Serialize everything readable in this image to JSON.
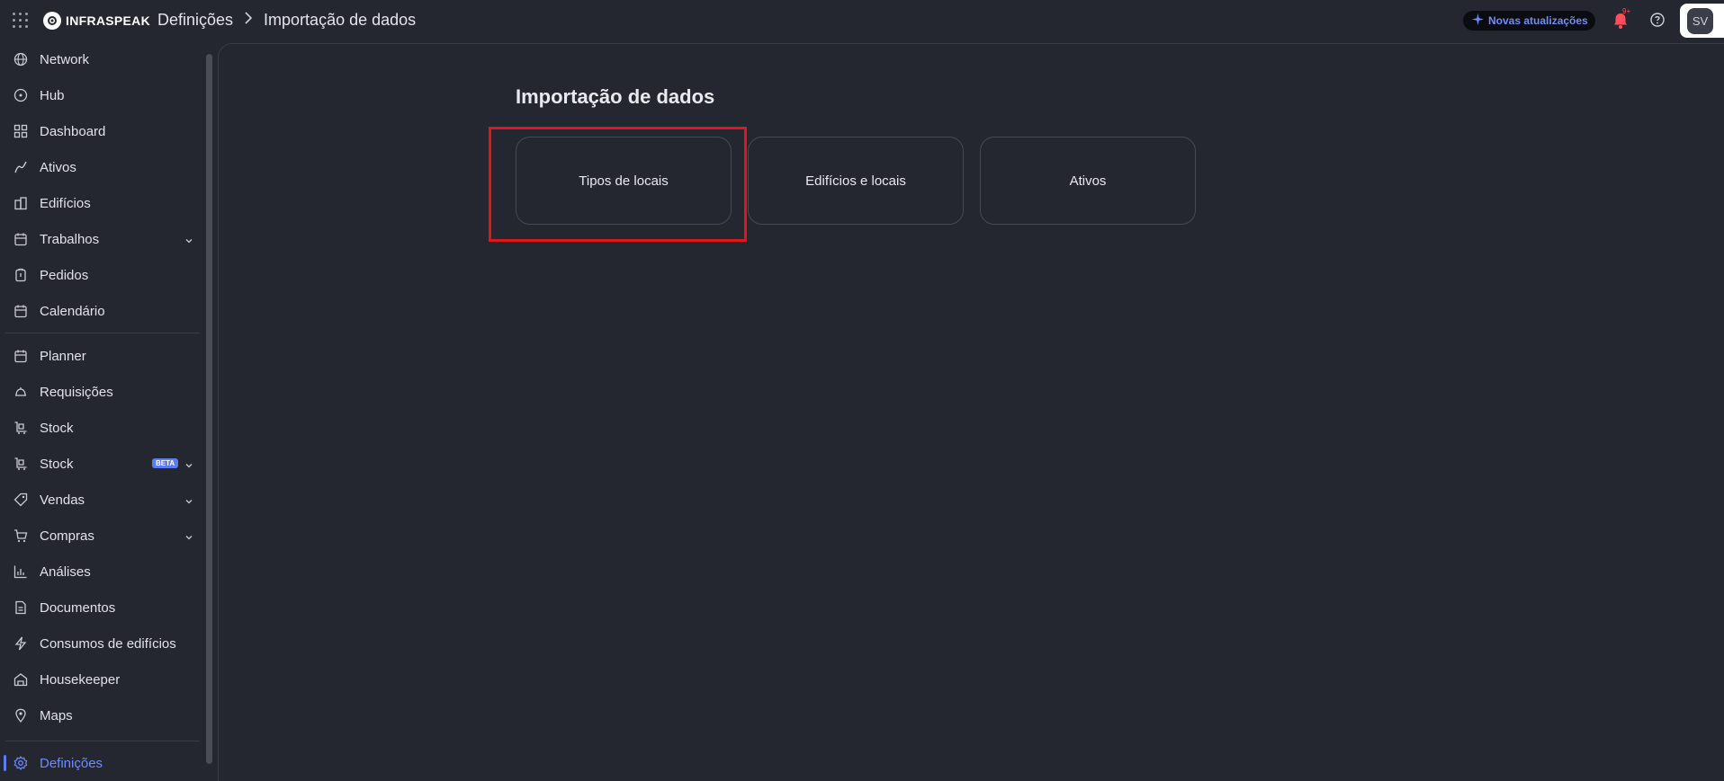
{
  "brand": {
    "name": "INFRASPEAK"
  },
  "breadcrumb": {
    "parent": "Definições",
    "current": "Importação de dados"
  },
  "header": {
    "updates_label": "Novas atualizações",
    "notification_badge": "9+",
    "avatar_initials": "SV"
  },
  "sidebar": {
    "items": [
      {
        "label": "Network",
        "icon": "network-icon"
      },
      {
        "label": "Hub",
        "icon": "hub-icon"
      },
      {
        "label": "Dashboard",
        "icon": "dashboard-icon"
      },
      {
        "label": "Ativos",
        "icon": "assets-icon"
      },
      {
        "label": "Edifícios",
        "icon": "buildings-icon"
      },
      {
        "label": "Trabalhos",
        "icon": "work-icon",
        "expandable": true
      },
      {
        "label": "Pedidos",
        "icon": "requests-icon"
      },
      {
        "label": "Calendário",
        "icon": "calendar-icon"
      },
      {
        "label": "Planner",
        "icon": "planner-icon"
      },
      {
        "label": "Requisições",
        "icon": "requisitions-icon"
      },
      {
        "label": "Stock",
        "icon": "stock-icon"
      },
      {
        "label": "Stock",
        "icon": "stock-icon",
        "badge": "BETA",
        "expandable": true
      },
      {
        "label": "Vendas",
        "icon": "sales-icon",
        "expandable": true
      },
      {
        "label": "Compras",
        "icon": "cart-icon",
        "expandable": true
      },
      {
        "label": "Análises",
        "icon": "analytics-icon"
      },
      {
        "label": "Documentos",
        "icon": "documents-icon"
      },
      {
        "label": "Consumos de edifícios",
        "icon": "energy-icon"
      },
      {
        "label": "Housekeeper",
        "icon": "housekeeper-icon"
      },
      {
        "label": "Maps",
        "icon": "map-pin-icon"
      },
      {
        "label": "Definições",
        "icon": "gear-icon",
        "active": true
      }
    ]
  },
  "main": {
    "title": "Importação de dados",
    "cards": [
      {
        "label": "Tipos de locais",
        "highlighted": true
      },
      {
        "label": "Edifícios e locais"
      },
      {
        "label": "Ativos"
      }
    ]
  },
  "colors": {
    "accent": "#5b7cf5",
    "background": "#242630",
    "highlight": "#e0161b"
  }
}
